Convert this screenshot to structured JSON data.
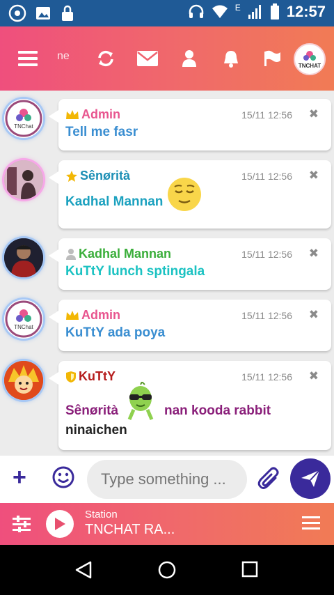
{
  "status": {
    "time": "12:57",
    "network": "E"
  },
  "topbar": {
    "ticker": "ne",
    "logo": "TNCHAT"
  },
  "messages": [
    {
      "name": "Admin",
      "rank": "crown",
      "name_color": "#e8558f",
      "time": "15/11 12:56",
      "text": "Tell me fasr",
      "text_color": "#3a8ed1"
    },
    {
      "name": "Sênørità",
      "rank": "star",
      "name_color": "#1c8fb5",
      "time": "15/11 12:56",
      "text": "Kadhal Mannan",
      "text_color": "#1ba1bf",
      "emoji": "relieved-face"
    },
    {
      "name": "Kadhal Mannan",
      "rank": "user",
      "name_color": "#3aae3a",
      "time": "15/11 12:56",
      "text": "KuTtY lunch sptingala",
      "text_color": "#1bc2c2"
    },
    {
      "name": "Admin",
      "rank": "crown",
      "name_color": "#e8558f",
      "time": "15/11 12:56",
      "text": "KuTtY ada poya",
      "text_color": "#3a8ed1"
    },
    {
      "name": "KuTtY",
      "rank": "shield",
      "name_color": "#b51c1c",
      "time": "15/11 12:56",
      "text_a": "Sênørità",
      "text_b": "nan kooda rabbit",
      "text_c": "ninaichen",
      "text_color": "#8a1f7a",
      "sticker": "green-alien"
    }
  ],
  "input": {
    "placeholder": "Type something ..."
  },
  "player": {
    "label": "Station",
    "name": "TNCHAT RA..."
  },
  "colors": {
    "accent": "#3a2a9b",
    "gradient_start": "#ef4f7d",
    "gradient_end": "#f17b55",
    "statusbar": "#1f5a96"
  }
}
